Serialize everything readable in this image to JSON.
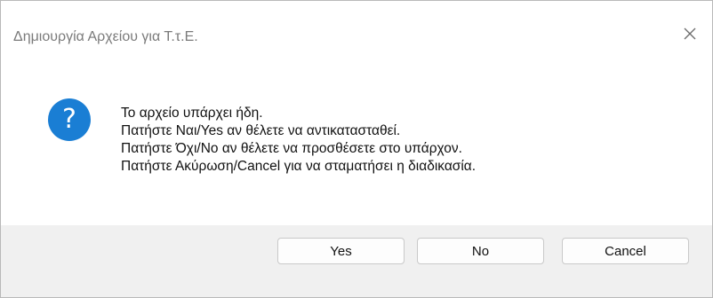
{
  "window": {
    "title": "Δημιουργία Αρχείου για Τ.τ.Ε.",
    "close_icon": "close-icon"
  },
  "message": {
    "icon": "question-icon",
    "icon_glyph": "?",
    "icon_color": "#1a7ed4",
    "lines": [
      "Το αρχείο υπάρχει ήδη.",
      "Πατήστε Ναι/Yes αν θέλετε να αντικατασταθεί.",
      "Πατήστε Όχι/No αν θέλετε να προσθέσετε στο υπάρχον.",
      "Πατήστε Ακύρωση/Cancel για να σταματήσει η διαδικασία."
    ]
  },
  "buttons": {
    "yes_label": "Yes",
    "no_label": "No",
    "cancel_label": "Cancel"
  }
}
